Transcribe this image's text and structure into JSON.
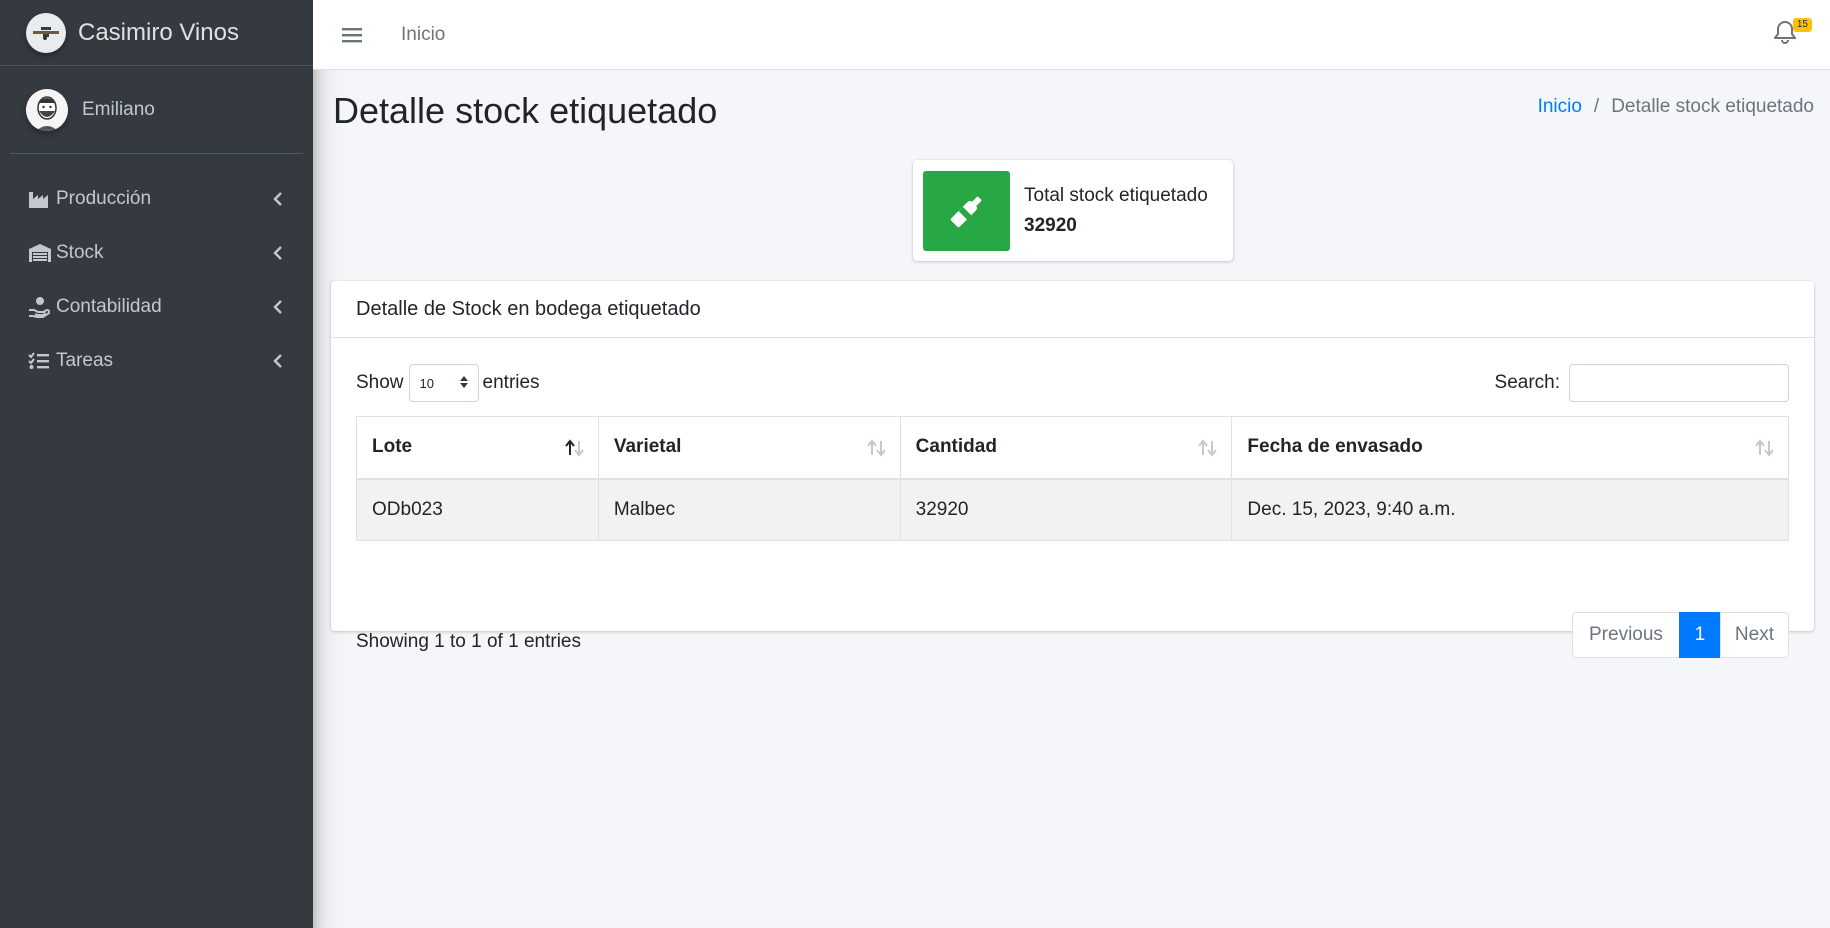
{
  "brand": {
    "name": "Casimiro Vinos"
  },
  "user": {
    "name": "Emiliano"
  },
  "sidebar": {
    "items": [
      {
        "label": "Producción",
        "icon": "industry-icon"
      },
      {
        "label": "Stock",
        "icon": "warehouse-icon"
      },
      {
        "label": "Contabilidad",
        "icon": "hand-holding-dollar-icon"
      },
      {
        "label": "Tareas",
        "icon": "tasks-icon"
      }
    ]
  },
  "topbar": {
    "home_link": "Inicio",
    "notification_count": "15"
  },
  "page": {
    "title": "Detalle stock etiquetado"
  },
  "breadcrumb": {
    "home": "Inicio",
    "separator": "/",
    "current": "Detalle stock etiquetado"
  },
  "info_box": {
    "label": "Total stock etiquetado",
    "value": "32920",
    "color": "#28a745",
    "icon": "wine-bottle-icon"
  },
  "card": {
    "title": "Detalle de Stock en bodega etiquetado",
    "length": {
      "show": "Show",
      "value": "10",
      "entries": "entries"
    },
    "search": {
      "label": "Search:",
      "value": ""
    },
    "table": {
      "columns": [
        "Lote",
        "Varietal",
        "Cantidad",
        "Fecha de envasado"
      ],
      "rows": [
        [
          "ODb023",
          "Malbec",
          "32920",
          "Dec. 15, 2023, 9:40 a.m."
        ]
      ]
    },
    "info": "Showing 1 to 1 of 1 entries",
    "pagination": {
      "previous": "Previous",
      "current": "1",
      "next": "Next"
    }
  },
  "colors": {
    "sidebar_bg": "#343a40",
    "accent": "#007bff",
    "success": "#28a745",
    "badge": "#ffc107"
  }
}
